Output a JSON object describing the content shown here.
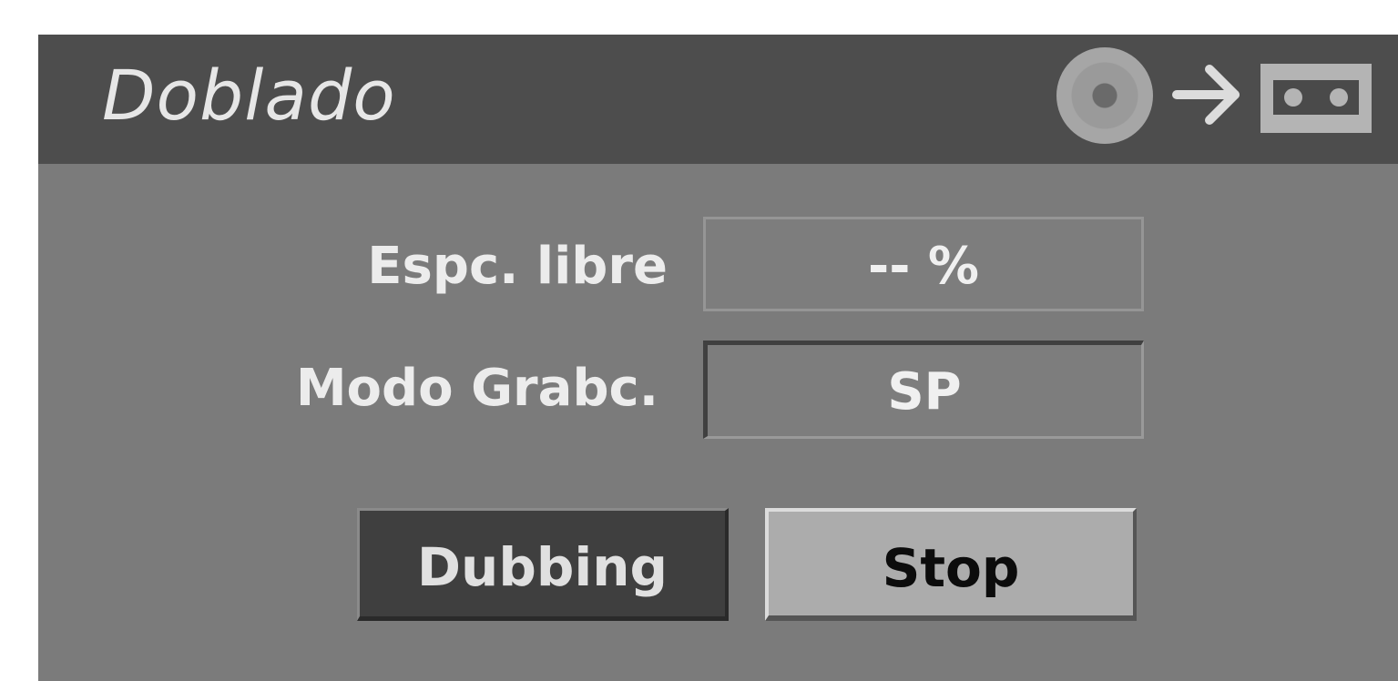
{
  "dialog": {
    "title": "Doblado",
    "icons": [
      "disc-icon",
      "arrow-right-icon",
      "vhs-tape-icon"
    ]
  },
  "fields": {
    "free_space": {
      "label": "Espc. libre",
      "value": "-- %"
    },
    "record_mode": {
      "label": "Modo Grabc.",
      "value": "SP"
    }
  },
  "buttons": {
    "dubbing": "Dubbing",
    "stop": "Stop"
  },
  "colors": {
    "panel_bg": "#7b7b7b",
    "title_bar_bg": "#4d4d4d",
    "dubbing_bg": "#3f3f3f",
    "stop_bg": "#acacac"
  }
}
